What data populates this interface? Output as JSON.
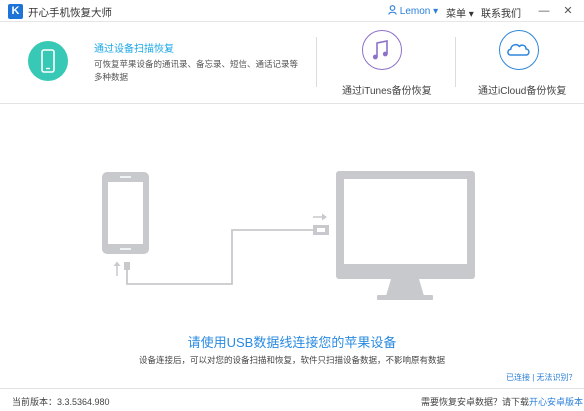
{
  "titlebar": {
    "logo_letter": "K",
    "app_title": "开心手机恢复大师",
    "user_name": "Lemon",
    "menu_label": "菜单",
    "contact_label": "联系我们",
    "minimize_glyph": "—",
    "close_glyph": "✕"
  },
  "options": {
    "device_scan": {
      "title": "通过设备扫描恢复",
      "description": "可恢复苹果设备的通讯录、备忘录、短信、通话记录等多种数据"
    },
    "itunes": {
      "label": "通过iTunes备份恢复"
    },
    "icloud": {
      "label": "通过iCloud备份恢复"
    }
  },
  "main": {
    "headline": "请使用USB数据线连接您的苹果设备",
    "subline": "设备连接后，可以对您的设备扫描和恢复，软件只扫描设备数据，不影响原有数据",
    "help_link_1": "已连接",
    "help_link_2": "无法识别？"
  },
  "footer": {
    "version": "当前版本：3.3.5364.980",
    "android_hint": "需要恢复安卓数据？请下载",
    "android_link": "开心安卓版本"
  },
  "colors": {
    "accent_blue": "#2a8be0",
    "teal": "#37c9b6",
    "purple": "#8d71c7",
    "cloud_blue": "#2e86db",
    "device_grey": "#c7c9cc"
  }
}
